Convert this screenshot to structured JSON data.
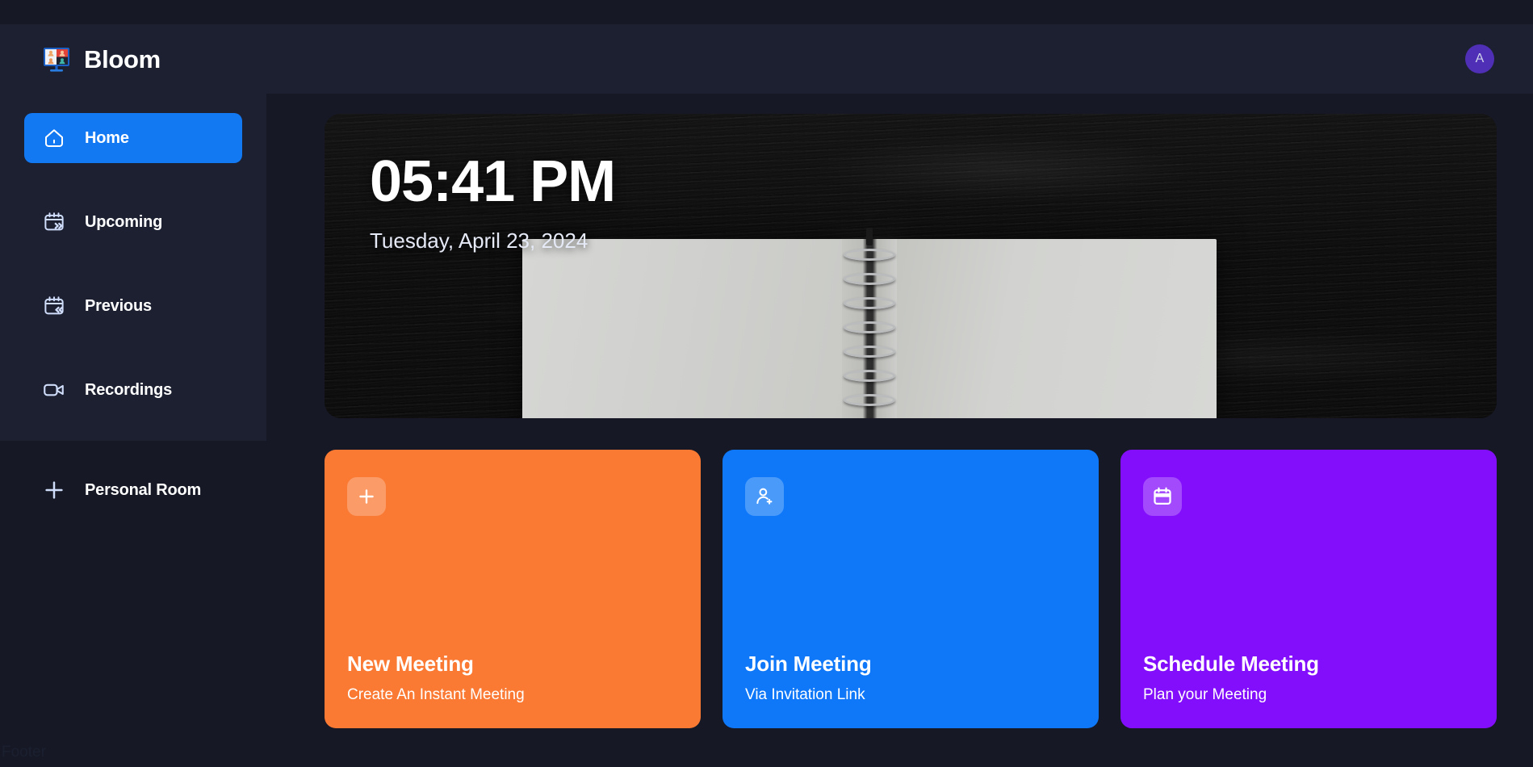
{
  "app": {
    "brand_name": "Bloom",
    "logo_icon": "video-conference-icon",
    "background_color": "#161925",
    "panel_color": "#1c2031",
    "accent_color": "#1379f3"
  },
  "navbar": {
    "avatar_initial": "A",
    "avatar_color": "#4f2fb5",
    "avatar_label": "user-avatar"
  },
  "sidebar": {
    "items": [
      {
        "label": "Home",
        "icon": "home-icon",
        "active": true
      },
      {
        "label": "Upcoming",
        "icon": "calendar-next-icon",
        "active": false
      },
      {
        "label": "Previous",
        "icon": "calendar-prev-icon",
        "active": false
      },
      {
        "label": "Recordings",
        "icon": "video-camera-icon",
        "active": false
      },
      {
        "label": "Personal Room",
        "icon": "plus-icon",
        "active": false
      }
    ]
  },
  "hero": {
    "time": "05:41 PM",
    "date": "Tuesday, April 23, 2024",
    "background_image": "open-spiral-notebook-on-dark-wood-table"
  },
  "cards": [
    {
      "title": "New Meeting",
      "subtitle": "Create An Instant Meeting",
      "icon": "plus-icon",
      "color": "#fa7a34"
    },
    {
      "title": "Join Meeting",
      "subtitle": "Via Invitation Link",
      "icon": "person-add-icon",
      "color": "#0e78f9"
    },
    {
      "title": "Schedule Meeting",
      "subtitle": "Plan your Meeting",
      "icon": "calendar-icon",
      "color": "#830efb"
    }
  ],
  "footer": {
    "label": "Footer"
  }
}
